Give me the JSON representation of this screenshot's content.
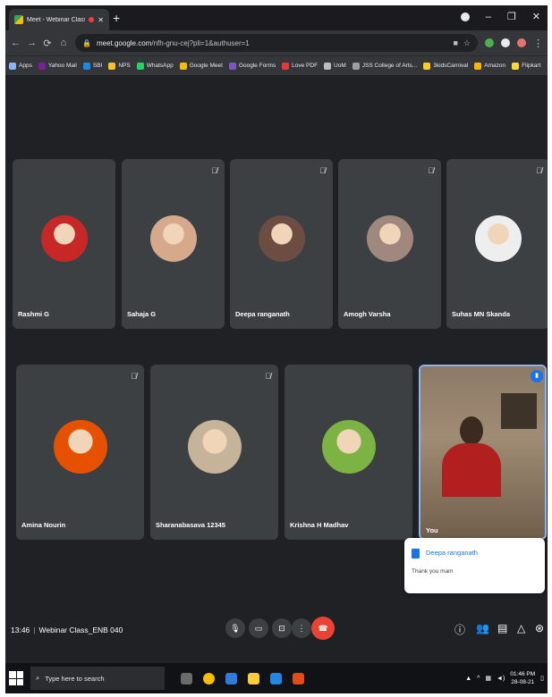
{
  "browser": {
    "tab_title": "Meet - Webinar Class ENB",
    "url_domain": "meet.google.com",
    "url_path": "/nfh-gnu-cej?pli=1&authuser=1"
  },
  "bookmarks": [
    {
      "label": "Apps",
      "icon": "apps-icon",
      "color": "#8ab4f8"
    },
    {
      "label": "Yahoo Mail",
      "icon": "yahoo-icon",
      "color": "#7b1fa2"
    },
    {
      "label": "SBI",
      "icon": "sbi-icon",
      "color": "#1e88e5"
    },
    {
      "label": "NPS",
      "icon": "nps-icon",
      "color": "#fbc02d"
    },
    {
      "label": "WhatsApp",
      "icon": "whatsapp-icon",
      "color": "#25d366"
    },
    {
      "label": "Google Meet",
      "icon": "meet-icon",
      "color": "#fbbc04"
    },
    {
      "label": "Google Forms",
      "icon": "forms-icon",
      "color": "#7e57c2"
    },
    {
      "label": "Love PDF",
      "icon": "pdf-icon",
      "color": "#e53935"
    },
    {
      "label": "UoM",
      "icon": "uom-icon",
      "color": "#bdbdbd"
    },
    {
      "label": "JSS College of Arts...",
      "icon": "college-icon",
      "color": "#9e9e9e"
    },
    {
      "label": "3kidsCarnival",
      "icon": "carnival-icon",
      "color": "#ffca28"
    },
    {
      "label": "Amazon",
      "icon": "amazon-icon",
      "color": "#ffb300"
    },
    {
      "label": "Flipkart",
      "icon": "flipkart-icon",
      "color": "#fdd835"
    }
  ],
  "reading_list": "Reading list",
  "participants_row1": [
    {
      "name": "Rashmi G",
      "muted": false,
      "avatar_color": "#c62828"
    },
    {
      "name": "Sahaja G",
      "muted": true,
      "avatar_color": "#d7a98c"
    },
    {
      "name": "Deepa ranganath",
      "muted": true,
      "avatar_color": "#6d4c41"
    },
    {
      "name": "Amogh Varsha",
      "muted": true,
      "avatar_color": "#a1887f"
    },
    {
      "name": "Suhas MN Skanda",
      "muted": true,
      "avatar_color": "#eeeeee"
    }
  ],
  "participants_row2": [
    {
      "name": "Amina Nourin",
      "muted": true,
      "avatar_color": "#e65100"
    },
    {
      "name": "Sharanabasava 12345",
      "muted": true,
      "avatar_color": "#c5b49a"
    },
    {
      "name": "Krishna H Madhav",
      "muted": false,
      "avatar_color": "#7cb342"
    }
  ],
  "self_tile": {
    "name": "You"
  },
  "chat_popup": {
    "sender": "Deepa ranganath",
    "message": "Thank you mam"
  },
  "meeting": {
    "time": "13:46",
    "separator": "|",
    "name": "Webinar Class_ENB 040"
  },
  "controls": [
    "mic-icon",
    "camera-icon",
    "present-icon",
    "more-icon",
    "end-call-icon"
  ],
  "right_controls": [
    "info-icon",
    "people-icon",
    "chat-icon",
    "activities-icon",
    "host-controls-icon"
  ],
  "taskbar": {
    "search_placeholder": "Type here to search",
    "time": "01:46 PM",
    "date": "28-08-21"
  }
}
